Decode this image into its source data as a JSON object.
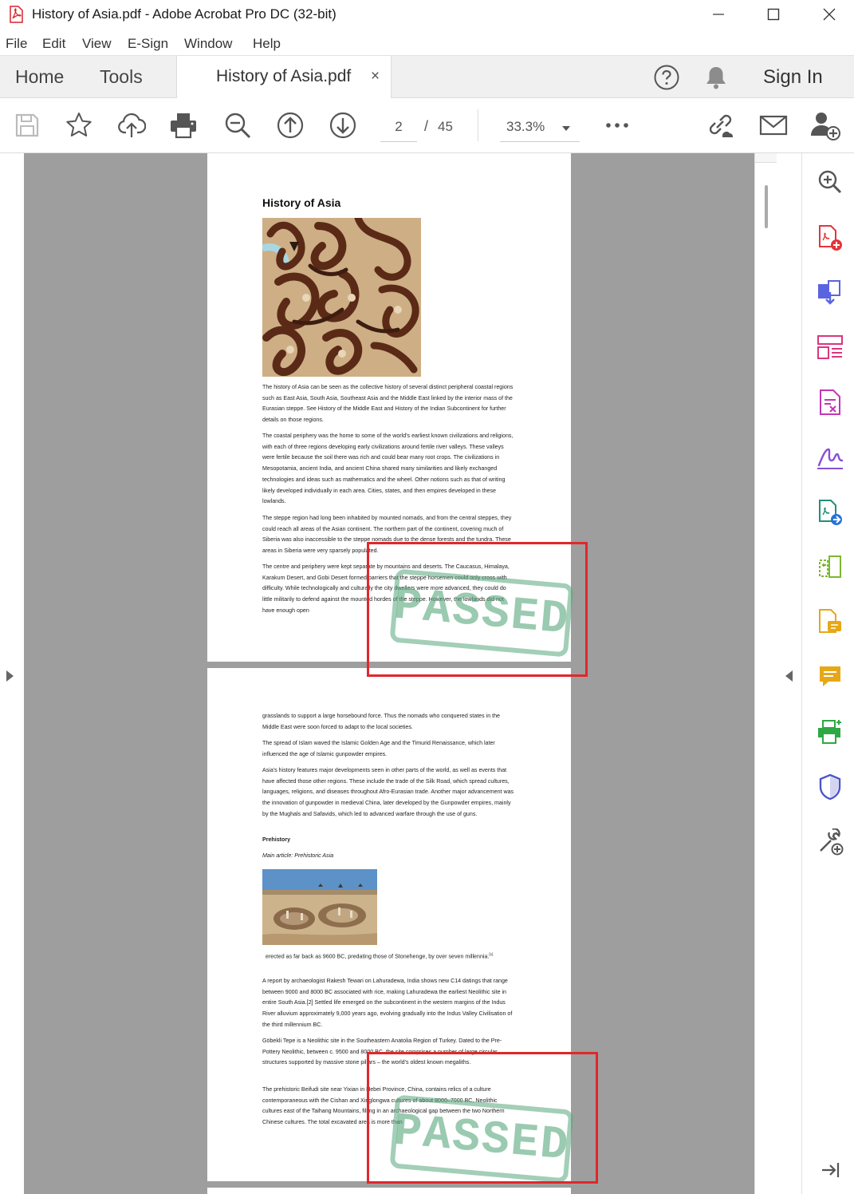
{
  "window": {
    "title": "History of Asia.pdf - Adobe Acrobat Pro DC (32-bit)"
  },
  "menu": [
    "File",
    "Edit",
    "View",
    "E-Sign",
    "Window",
    "Help"
  ],
  "tabs": {
    "home": "Home",
    "tools": "Tools",
    "document": "History of Asia.pdf",
    "close": "×"
  },
  "header": {
    "sign_in": "Sign In"
  },
  "toolbar": {
    "page_current": "2",
    "page_sep": "/",
    "page_total": "45",
    "zoom": "33.3%"
  },
  "page1": {
    "title": "History of Asia",
    "paragraphs": [
      "The history of Asia can be seen as the collective history of several distinct peripheral coastal regions such as East Asia, South Asia, Southeast Asia and the Middle East linked by the interior mass of the Eurasian steppe. See History of the Middle East and History of the Indian Subcontinent for further details on those regions.",
      "The coastal periphery was the home to some of the world's earliest known civilizations and religions, with each of three regions developing early civilizations around fertile river valleys. These valleys were fertile because the soil there was rich and could bear many root crops. The civilizations in Mesopotamia, ancient India, and ancient China shared many similarities and likely exchanged technologies and ideas such as mathematics and the wheel. Other notions such as that of writing likely developed individually in each area. Cities, states, and then empires developed in these lowlands.",
      "The steppe region had long been inhabited by mounted nomads, and from the central steppes, they could reach all areas of the Asian continent. The northern part of the continent, covering much of Siberia was also inaccessible to the steppe nomads due to the dense forests and the tundra. These areas in Siberia were very sparsely populated.",
      "The centre and periphery were kept separate by mountains and deserts. The Caucasus, Himalaya, Karakum Desert, and Gobi Desert formed barriers that the steppe horsemen could only cross with difficulty. While technologically and culturally the city dwellers were more advanced, they could do little militarily to defend against the mounted hordes of the steppe. However, the lowlands did not have enough open"
    ],
    "stamp": "PASSED"
  },
  "page2": {
    "paragraphs_top": [
      "grasslands to support a large horsebound force. Thus the nomads who conquered states in the Middle East were soon forced to adapt to the local societies.",
      "The spread of Islam waved the Islamic Golden Age and the Timurid Renaissance, which later influenced the age of Islamic gunpowder empires.",
      "Asia's history features major developments seen in other parts of the world, as well as events that have affected those other regions. These include the trade of the Silk Road, which spread cultures, languages, religions, and diseases throughout Afro-Eurasian trade. Another major advancement was the innovation of gunpowder in medieval China, later developed by the Gunpowder empires, mainly by the Mughals and Safavids, which led to advanced warfare through the use of guns."
    ],
    "subheading": "Prehistory",
    "main_article": "Main article: Prehistoric Asia",
    "caption": "erected as far back as 9600 BC, predating those of Stonehenge, by over seven millennia.",
    "caption_ref": "[1]",
    "paragraphs_bottom": [
      "A report by archaeologist Rakesh Tewari on Lahuradewa, India shows new C14 datings that range between 9000 and 8000 BC associated with rice, making Lahuradewa the earliest Neolithic site in entire South Asia.[2] Settled life emerged on the subcontinent in the western margins of the Indus River alluvium approximately 9,000 years ago, evolving gradually into the Indus Valley Civilisation of the third millennium BC.",
      "Göbekli Tepe is a Neolithic site in the Southeastern Anatolia Region of Turkey. Dated to the Pre-Pottery Neolithic, between c. 9500 and 8000 BC, the site comprises a number of large circular structures supported by massive stone pillars – the world's oldest known megaliths.",
      "The prehistoric Beifudi site near Yixian in Hebei Province, China, contains relics of a culture contemporaneous with the Cishan and Xinglongwa cultures of about 8000–7000 BC, Neolithic cultures east of the Taihang Mountains, filling in an archaeological gap between the two Northern Chinese cultures. The total excavated area is more than"
    ],
    "stamp": "PASSED"
  },
  "colors": {
    "annotation_box": "#e0272c",
    "stamp_green": "#57a67b",
    "accent_red": "#d8232a"
  }
}
